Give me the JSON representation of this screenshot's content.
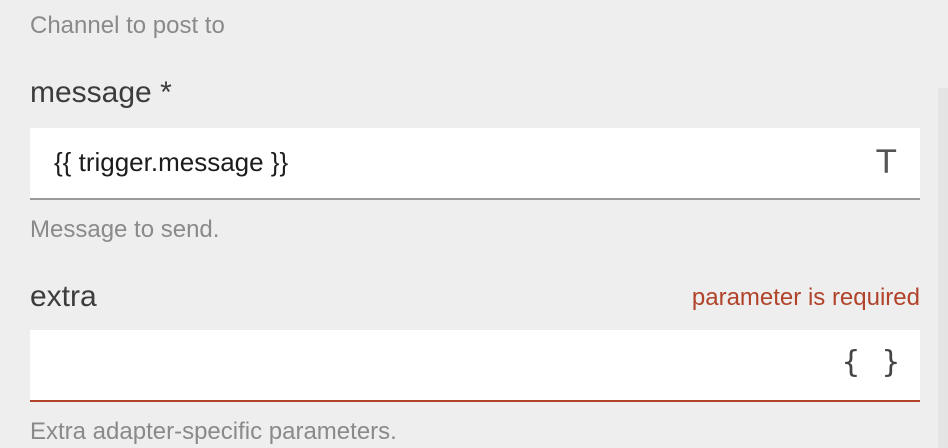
{
  "channel_field": {
    "help": "Channel to post to"
  },
  "message_field": {
    "label": "message *",
    "value": "{{ trigger.message }}",
    "type_icon": "text-type-icon",
    "type_glyph": "T",
    "help": "Message to send."
  },
  "extra_field": {
    "label": "extra",
    "error": "parameter is required",
    "value": "",
    "type_icon": "json-braces-icon",
    "type_glyph": "{ }",
    "help": "Extra adapter-specific parameters.",
    "error_color": "#b0432a"
  }
}
